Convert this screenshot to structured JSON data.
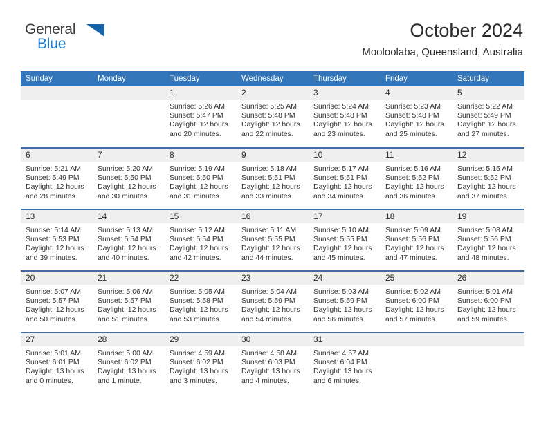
{
  "brand": {
    "line1": "General",
    "line2": "Blue",
    "triangle_color": "#1763a8",
    "blue_color": "#1b7fd4"
  },
  "header": {
    "title": "October 2024",
    "subtitle": "Mooloolaba, Queensland, Australia"
  },
  "theme": {
    "header_blue": "#3275b8",
    "row_line": "#3c6ea5",
    "daynum_band": "#efefef"
  },
  "calendar": {
    "weekdays": [
      "Sunday",
      "Monday",
      "Tuesday",
      "Wednesday",
      "Thursday",
      "Friday",
      "Saturday"
    ],
    "weeks": [
      [
        {
          "day": "",
          "sunrise": "",
          "sunset": "",
          "daylight": ""
        },
        {
          "day": "",
          "sunrise": "",
          "sunset": "",
          "daylight": ""
        },
        {
          "day": "1",
          "sunrise": "Sunrise: 5:26 AM",
          "sunset": "Sunset: 5:47 PM",
          "daylight": "Daylight: 12 hours and 20 minutes."
        },
        {
          "day": "2",
          "sunrise": "Sunrise: 5:25 AM",
          "sunset": "Sunset: 5:48 PM",
          "daylight": "Daylight: 12 hours and 22 minutes."
        },
        {
          "day": "3",
          "sunrise": "Sunrise: 5:24 AM",
          "sunset": "Sunset: 5:48 PM",
          "daylight": "Daylight: 12 hours and 23 minutes."
        },
        {
          "day": "4",
          "sunrise": "Sunrise: 5:23 AM",
          "sunset": "Sunset: 5:48 PM",
          "daylight": "Daylight: 12 hours and 25 minutes."
        },
        {
          "day": "5",
          "sunrise": "Sunrise: 5:22 AM",
          "sunset": "Sunset: 5:49 PM",
          "daylight": "Daylight: 12 hours and 27 minutes."
        }
      ],
      [
        {
          "day": "6",
          "sunrise": "Sunrise: 5:21 AM",
          "sunset": "Sunset: 5:49 PM",
          "daylight": "Daylight: 12 hours and 28 minutes."
        },
        {
          "day": "7",
          "sunrise": "Sunrise: 5:20 AM",
          "sunset": "Sunset: 5:50 PM",
          "daylight": "Daylight: 12 hours and 30 minutes."
        },
        {
          "day": "8",
          "sunrise": "Sunrise: 5:19 AM",
          "sunset": "Sunset: 5:50 PM",
          "daylight": "Daylight: 12 hours and 31 minutes."
        },
        {
          "day": "9",
          "sunrise": "Sunrise: 5:18 AM",
          "sunset": "Sunset: 5:51 PM",
          "daylight": "Daylight: 12 hours and 33 minutes."
        },
        {
          "day": "10",
          "sunrise": "Sunrise: 5:17 AM",
          "sunset": "Sunset: 5:51 PM",
          "daylight": "Daylight: 12 hours and 34 minutes."
        },
        {
          "day": "11",
          "sunrise": "Sunrise: 5:16 AM",
          "sunset": "Sunset: 5:52 PM",
          "daylight": "Daylight: 12 hours and 36 minutes."
        },
        {
          "day": "12",
          "sunrise": "Sunrise: 5:15 AM",
          "sunset": "Sunset: 5:52 PM",
          "daylight": "Daylight: 12 hours and 37 minutes."
        }
      ],
      [
        {
          "day": "13",
          "sunrise": "Sunrise: 5:14 AM",
          "sunset": "Sunset: 5:53 PM",
          "daylight": "Daylight: 12 hours and 39 minutes."
        },
        {
          "day": "14",
          "sunrise": "Sunrise: 5:13 AM",
          "sunset": "Sunset: 5:54 PM",
          "daylight": "Daylight: 12 hours and 40 minutes."
        },
        {
          "day": "15",
          "sunrise": "Sunrise: 5:12 AM",
          "sunset": "Sunset: 5:54 PM",
          "daylight": "Daylight: 12 hours and 42 minutes."
        },
        {
          "day": "16",
          "sunrise": "Sunrise: 5:11 AM",
          "sunset": "Sunset: 5:55 PM",
          "daylight": "Daylight: 12 hours and 44 minutes."
        },
        {
          "day": "17",
          "sunrise": "Sunrise: 5:10 AM",
          "sunset": "Sunset: 5:55 PM",
          "daylight": "Daylight: 12 hours and 45 minutes."
        },
        {
          "day": "18",
          "sunrise": "Sunrise: 5:09 AM",
          "sunset": "Sunset: 5:56 PM",
          "daylight": "Daylight: 12 hours and 47 minutes."
        },
        {
          "day": "19",
          "sunrise": "Sunrise: 5:08 AM",
          "sunset": "Sunset: 5:56 PM",
          "daylight": "Daylight: 12 hours and 48 minutes."
        }
      ],
      [
        {
          "day": "20",
          "sunrise": "Sunrise: 5:07 AM",
          "sunset": "Sunset: 5:57 PM",
          "daylight": "Daylight: 12 hours and 50 minutes."
        },
        {
          "day": "21",
          "sunrise": "Sunrise: 5:06 AM",
          "sunset": "Sunset: 5:57 PM",
          "daylight": "Daylight: 12 hours and 51 minutes."
        },
        {
          "day": "22",
          "sunrise": "Sunrise: 5:05 AM",
          "sunset": "Sunset: 5:58 PM",
          "daylight": "Daylight: 12 hours and 53 minutes."
        },
        {
          "day": "23",
          "sunrise": "Sunrise: 5:04 AM",
          "sunset": "Sunset: 5:59 PM",
          "daylight": "Daylight: 12 hours and 54 minutes."
        },
        {
          "day": "24",
          "sunrise": "Sunrise: 5:03 AM",
          "sunset": "Sunset: 5:59 PM",
          "daylight": "Daylight: 12 hours and 56 minutes."
        },
        {
          "day": "25",
          "sunrise": "Sunrise: 5:02 AM",
          "sunset": "Sunset: 6:00 PM",
          "daylight": "Daylight: 12 hours and 57 minutes."
        },
        {
          "day": "26",
          "sunrise": "Sunrise: 5:01 AM",
          "sunset": "Sunset: 6:00 PM",
          "daylight": "Daylight: 12 hours and 59 minutes."
        }
      ],
      [
        {
          "day": "27",
          "sunrise": "Sunrise: 5:01 AM",
          "sunset": "Sunset: 6:01 PM",
          "daylight": "Daylight: 13 hours and 0 minutes."
        },
        {
          "day": "28",
          "sunrise": "Sunrise: 5:00 AM",
          "sunset": "Sunset: 6:02 PM",
          "daylight": "Daylight: 13 hours and 1 minute."
        },
        {
          "day": "29",
          "sunrise": "Sunrise: 4:59 AM",
          "sunset": "Sunset: 6:02 PM",
          "daylight": "Daylight: 13 hours and 3 minutes."
        },
        {
          "day": "30",
          "sunrise": "Sunrise: 4:58 AM",
          "sunset": "Sunset: 6:03 PM",
          "daylight": "Daylight: 13 hours and 4 minutes."
        },
        {
          "day": "31",
          "sunrise": "Sunrise: 4:57 AM",
          "sunset": "Sunset: 6:04 PM",
          "daylight": "Daylight: 13 hours and 6 minutes."
        },
        {
          "day": "",
          "sunrise": "",
          "sunset": "",
          "daylight": ""
        },
        {
          "day": "",
          "sunrise": "",
          "sunset": "",
          "daylight": ""
        }
      ]
    ]
  }
}
